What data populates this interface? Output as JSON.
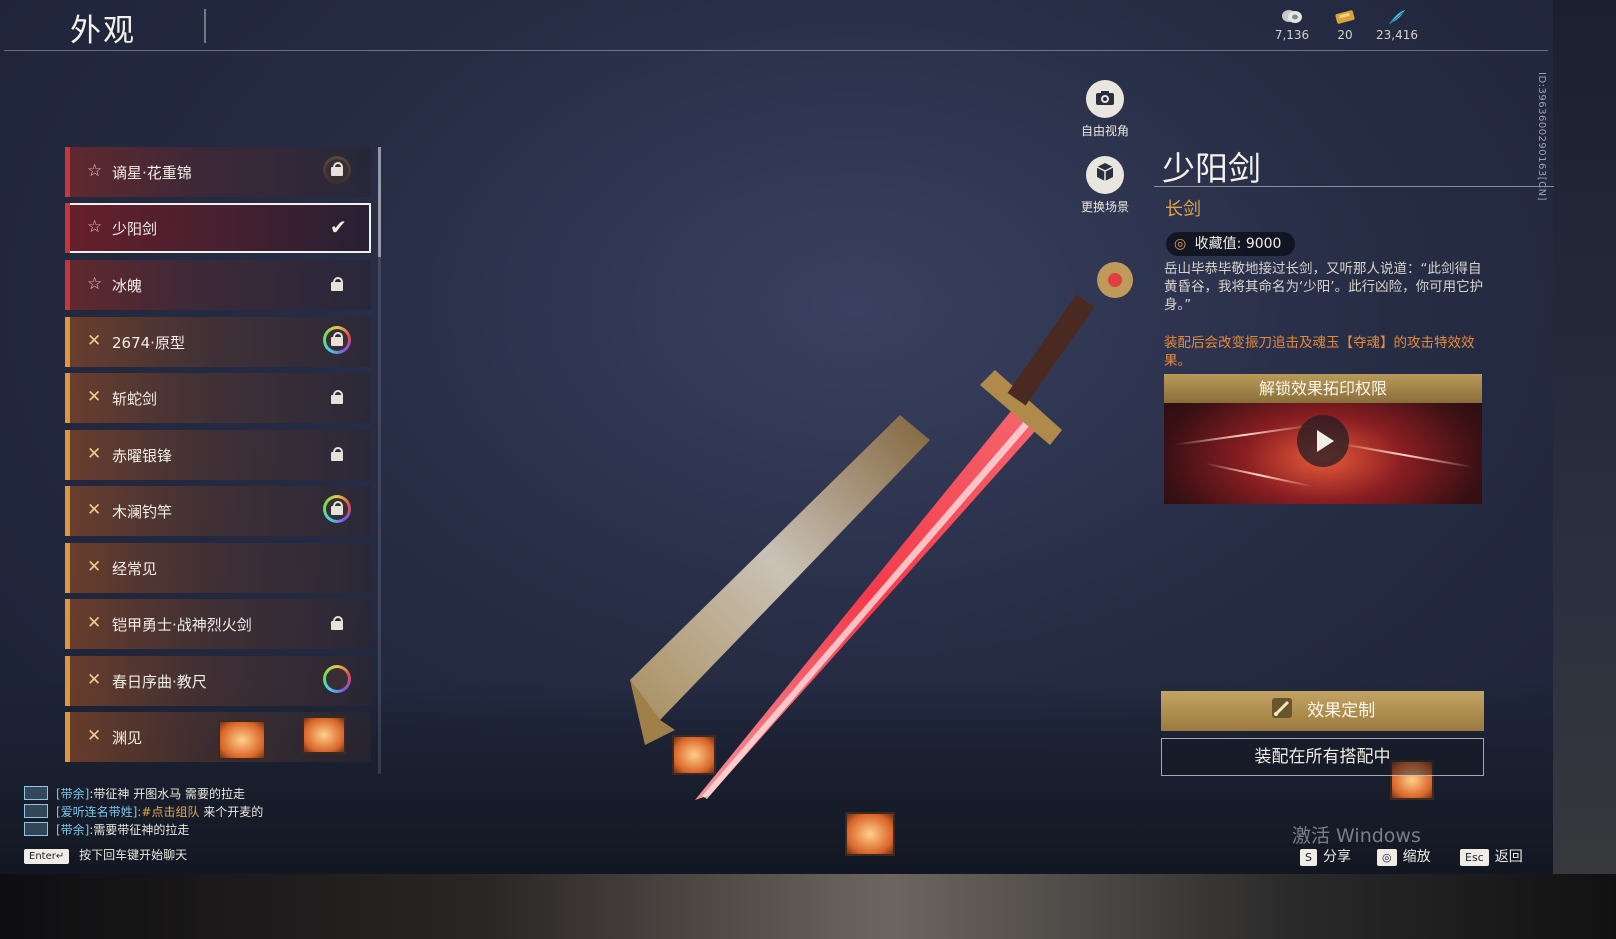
{
  "header": {
    "title": "外观",
    "currencies": [
      {
        "icon": "coin-stack-icon",
        "value": "7,136"
      },
      {
        "icon": "ticket-icon",
        "value": "20"
      },
      {
        "icon": "feather-icon",
        "value": "23,416"
      }
    ]
  },
  "list": {
    "items": [
      {
        "label": "谪星·花重锦",
        "star": "☆",
        "status": "locked-ring-dark"
      },
      {
        "label": "少阳剑",
        "star": "☆",
        "status": "selected"
      },
      {
        "label": "冰魄",
        "star": "☆",
        "status": "locked"
      },
      {
        "label": "2674·原型",
        "star": "✕",
        "status": "locked-ring"
      },
      {
        "label": "斩蛇剑",
        "star": "✕",
        "status": "locked"
      },
      {
        "label": "赤曜银锋",
        "star": "✕",
        "status": "locked"
      },
      {
        "label": "木澜钓竿",
        "star": "✕",
        "status": "locked-ring"
      },
      {
        "label": "经常见",
        "star": "✕",
        "status": "none"
      },
      {
        "label": "铠甲勇士·战神烈火剑",
        "star": "✕",
        "status": "locked"
      },
      {
        "label": "春日序曲·教尺",
        "star": "✕",
        "status": "ring"
      },
      {
        "label": "渊见",
        "star": "✕",
        "status": "locked"
      }
    ],
    "check_glyph": "✔"
  },
  "controls": {
    "free_view": "自由视角",
    "change_scene": "更换场景"
  },
  "detail": {
    "name": "少阳剑",
    "type": "长剑",
    "collection_label": "收藏值: 9000",
    "description": "岳山毕恭毕敬地接过长剑，又听那人说道：“此剑得自黄昏谷，我将其命名为‘少阳’。此行凶险，你可用它护身。”",
    "effect_note": "装配后会改变振刀追击及魂玉【夺魂】的攻击特效效果。",
    "video_title": "解锁效果拓印权限",
    "btn_custom": "效果定制",
    "btn_equip": "装配在所有搭配中"
  },
  "side_id": "ID:3963600290163[CN]",
  "chat": {
    "messages": [
      {
        "who": "[带余]",
        "text": ":带征神 开图水马 需要的拉走",
        "tag": ""
      },
      {
        "who": "[爱听连名带姓]",
        "text": " 来个开麦的",
        "tag": ":#点击组队"
      },
      {
        "who": "[带余]",
        "text": ":需要带征神的拉走",
        "tag": ""
      }
    ],
    "enter_key": "Enter↵",
    "enter_hint": "按下回车键开始聊天"
  },
  "hotkeys": [
    {
      "key": "S",
      "label": "分享"
    },
    {
      "key": "◎",
      "label": "缩放"
    },
    {
      "key": "Esc",
      "label": "返回"
    }
  ],
  "watermark": "激活 Windows",
  "colors": {
    "accent_gold": "#e0a34a",
    "accent_red": "#c7363a",
    "effect_orange": "#e58a3c"
  }
}
